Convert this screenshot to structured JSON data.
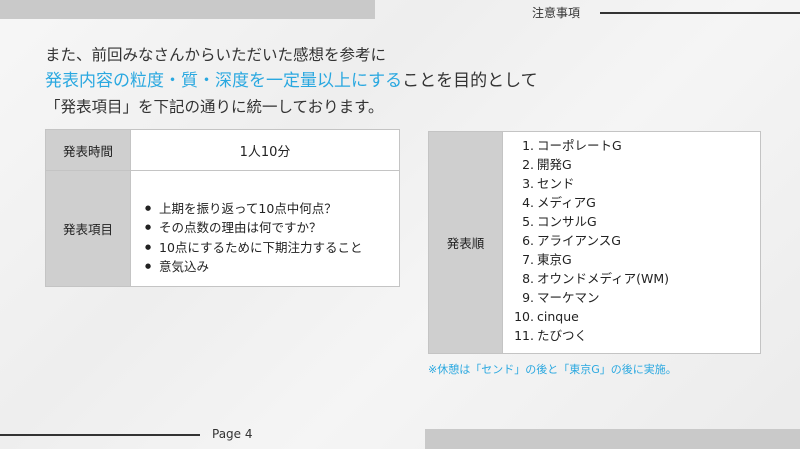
{
  "header": {
    "label": "注意事項"
  },
  "intro": {
    "line1": "また、前回みなさんからいただいた感想を参考に",
    "line2_highlight": "発表内容の粒度・質・深度を一定量以上にする",
    "line2_rest": "ことを目的として",
    "line3": "「発表項目」を下記の通りに統一しております。"
  },
  "details_table": {
    "time_label": "発表時間",
    "time_value": "1人10分",
    "items_label": "発表項目",
    "items": [
      "上期を振り返って10点中何点？",
      "その点数の理由は何ですか？",
      "10点にするために下期注力すること",
      "意気込み"
    ]
  },
  "order_table": {
    "label": "発表順",
    "entries": [
      {
        "num": "1.",
        "name": "コーポレートG"
      },
      {
        "num": "2.",
        "name": "開発G"
      },
      {
        "num": "3.",
        "name": "センド"
      },
      {
        "num": "4.",
        "name": "メディアG"
      },
      {
        "num": "5.",
        "name": "コンサルG"
      },
      {
        "num": "6.",
        "name": "アライアンスG"
      },
      {
        "num": "7.",
        "name": "東京G"
      },
      {
        "num": "8.",
        "name": "オウンドメディア(WM)"
      },
      {
        "num": "9.",
        "name": "マーケマン"
      },
      {
        "num": "10.",
        "name": "cinque"
      },
      {
        "num": "11.",
        "name": "たびつく"
      }
    ]
  },
  "note": "※休憩は「センド」の後と「東京G」の後に実施。",
  "footer": {
    "page_label": "Page 4"
  },
  "colors": {
    "accent": "#2aa8e0",
    "bar": "#c9c9c9",
    "table_head": "#cfcfcf"
  }
}
